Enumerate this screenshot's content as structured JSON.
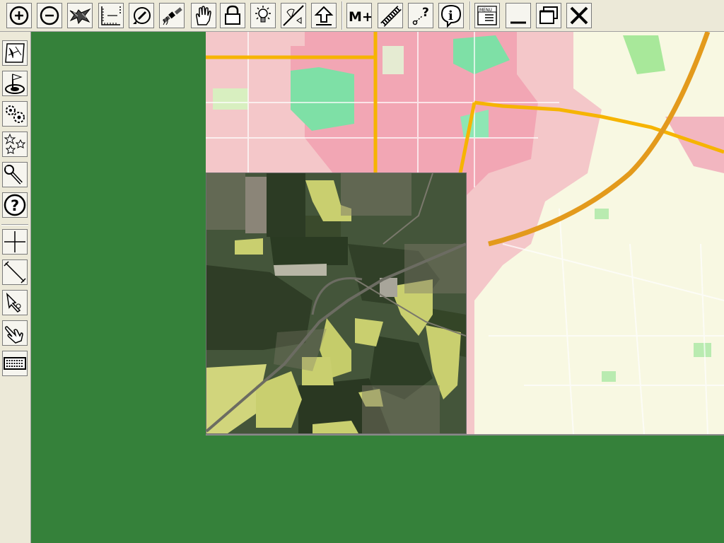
{
  "app": {
    "background_color": "#35813a",
    "toolbar_color": "#ece9d8"
  },
  "toolbar": {
    "buttons": [
      {
        "name": "zoom-in",
        "icon": "plus-circle-icon"
      },
      {
        "name": "zoom-out",
        "icon": "minus-circle-icon"
      },
      {
        "name": "eagle-view",
        "icon": "eagle-icon"
      },
      {
        "name": "scale",
        "icon": "ruler-frame-icon"
      },
      {
        "name": "rotate",
        "icon": "compass-rotate-icon"
      },
      {
        "name": "satellite",
        "icon": "satellite-icon"
      },
      {
        "name": "pan",
        "icon": "hand-icon"
      },
      {
        "name": "lock",
        "icon": "padlock-icon"
      },
      {
        "name": "brightness",
        "icon": "lightbulb-icon"
      },
      {
        "name": "layer-diagonal",
        "icon": "diagonal-layer-icon"
      },
      {
        "name": "upload",
        "icon": "arrow-up-icon"
      },
      {
        "name": "add-marker",
        "icon": "m-plus-icon",
        "label": "M+"
      },
      {
        "name": "track",
        "icon": "track-chain-icon"
      },
      {
        "name": "query-point",
        "icon": "question-point-icon",
        "label": "?"
      },
      {
        "name": "info",
        "icon": "info-icon",
        "label": "i"
      },
      {
        "name": "menu",
        "icon": "menu-icon",
        "label": "MENU"
      },
      {
        "name": "minimize-window",
        "icon": "minimize-icon"
      },
      {
        "name": "restore-window",
        "icon": "restore-icon"
      },
      {
        "name": "close-window",
        "icon": "close-icon"
      }
    ]
  },
  "sidebar": {
    "buttons": [
      {
        "name": "map-view",
        "icon": "map-sheet-icon"
      },
      {
        "name": "target-flag",
        "icon": "target-flag-icon"
      },
      {
        "name": "settings",
        "icon": "gears-icon"
      },
      {
        "name": "favorites",
        "icon": "stars-icon"
      },
      {
        "name": "tools",
        "icon": "wrench-icon"
      },
      {
        "name": "help",
        "icon": "help-circle-icon",
        "label": "?"
      },
      {
        "name": "crosshair",
        "icon": "crosshair-icon"
      },
      {
        "name": "measure",
        "icon": "measure-line-icon"
      },
      {
        "name": "select-pointer",
        "icon": "pointer-hand-icon"
      },
      {
        "name": "grab",
        "icon": "grab-hand-icon"
      },
      {
        "name": "keyboard",
        "icon": "keyboard-icon"
      }
    ]
  },
  "map": {
    "street_colors": {
      "urban": "#f2a6b4",
      "parks": "#7ee0a6",
      "land": "#f8f8e2",
      "main_road": "#f6b400",
      "highway": "#e39a1c"
    },
    "aerial_colors": {
      "forest": "#3d4c2e",
      "field_dark": "#344428",
      "field_light": "#c9cf6f",
      "settlement": "#7e7a6a"
    }
  }
}
